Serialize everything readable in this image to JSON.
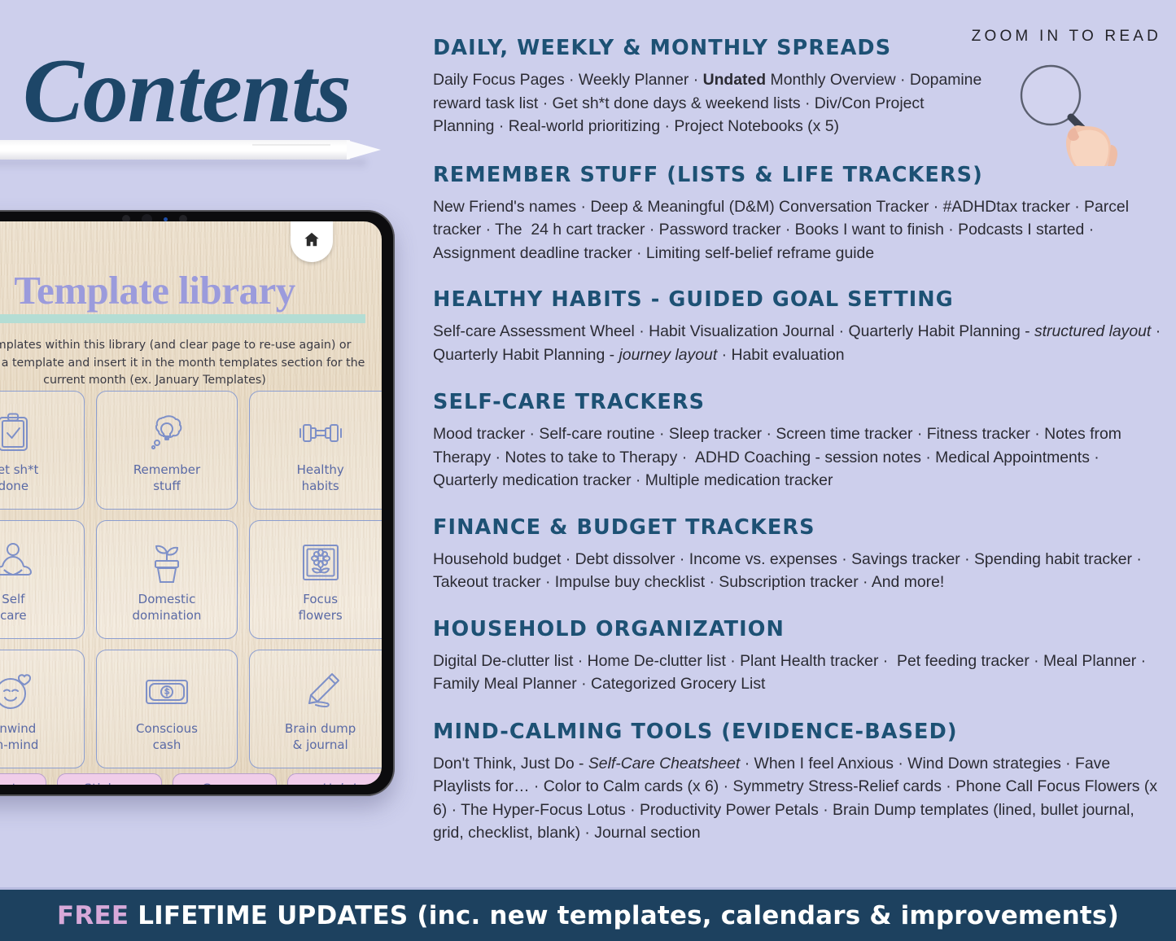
{
  "page": {
    "title": "Contents",
    "background_color": "#cdcfec",
    "heading_color": "#1d5174",
    "body_text_color": "#2b2b33"
  },
  "zoom_hint": {
    "label": "ZOOM IN TO READ",
    "icon": "magnifying-glass-in-hand"
  },
  "tablet": {
    "home_icon": "home-icon",
    "library_title": "Template library",
    "library_description": "Use templates within this library (and clear page to re-use again) or duplicate a template and insert it in the month templates section for the current month (ex. January Templates)",
    "tiles": [
      {
        "caption": "Get sh*t\ndone",
        "icon": "clipboard-check-icon"
      },
      {
        "caption": "Remember\nstuff",
        "icon": "lightbulb-thought-icon"
      },
      {
        "caption": "Healthy\nhabits",
        "icon": "dumbbell-icon"
      },
      {
        "caption": "Self\ncare",
        "icon": "meditation-icon"
      },
      {
        "caption": "Domestic\ndomination",
        "icon": "potted-plant-icon"
      },
      {
        "caption": "Focus\nflowers",
        "icon": "framed-flower-icon"
      },
      {
        "caption": "Unwind\nun-mind",
        "icon": "calm-face-heart-icon"
      },
      {
        "caption": "Conscious\ncash",
        "icon": "banknote-dollar-icon"
      },
      {
        "caption": "Brain dump\n& journal",
        "icon": "pencil-writing-icon"
      }
    ],
    "nav_buttons": [
      {
        "label": "Contents",
        "italic": false
      },
      {
        "label": "Stickers",
        "italic": false
      },
      {
        "label": "Covers",
        "italic": false
      },
      {
        "label": "Help!",
        "italic": true
      }
    ]
  },
  "sections": [
    {
      "heading": "Daily, Weekly & Monthly Spreads",
      "body_html": "Daily Focus Pages &middot; Weekly Planner &middot; <b>Undated</b> Monthly Overview &middot; Dopamine reward task list &middot; Get sh*t done days &amp; weekend lists &middot; Div/Con Project Planning &middot; Real-world prioritizing &middot; Project Notebooks (x 5)"
    },
    {
      "heading": "Remember Stuff (Lists & Life Trackers)",
      "body_html": "New Friend's names &middot; Deep &amp; Meaningful (D&amp;M) Conversation Tracker &middot; #ADHDtax tracker &middot; Parcel tracker &middot; The&nbsp; 24 h cart tracker &middot; Password tracker &middot; Books I want to finish &middot; Podcasts I started &middot; Assignment deadline tracker &middot; Limiting self-belief reframe guide"
    },
    {
      "heading": "Healthy Habits - Guided Goal Setting",
      "body_html": "Self-care Assessment Wheel &middot; Habit Visualization Journal &middot; Quarterly Habit Planning - <i>structured layout</i> &middot; Quarterly Habit Planning - <i>journey layout</i> &middot; Habit evaluation"
    },
    {
      "heading": "Self-Care Trackers",
      "body_html": "Mood tracker &middot; Self-care routine &middot; Sleep tracker &middot; Screen time tracker &middot; Fitness tracker &middot; Notes from Therapy &middot; Notes to take to Therapy &middot;&nbsp; ADHD Coaching - session notes &middot; Medical Appointments &middot; Quarterly medication tracker &middot; Multiple medication tracker"
    },
    {
      "heading": "Finance & Budget Trackers",
      "body_html": "Household budget &middot; Debt dissolver &middot; Income vs. expenses &middot; Savings tracker &middot; Spending habit tracker &middot; Takeout tracker &middot; Impulse buy checklist &middot; Subscription tracker &middot; And more!"
    },
    {
      "heading": "Household Organization",
      "body_html": "Digital De-clutter list &middot; Home De-clutter list &middot; Plant Health tracker &middot;&nbsp; Pet feeding tracker &middot; Meal Planner &middot; Family Meal Planner &middot; Categorized Grocery List"
    },
    {
      "heading": "Mind-Calming Tools (Evidence-Based)",
      "body_html": "Don't Think, Just Do - <i>Self-Care Cheatsheet</i> &middot; When I feel Anxious &middot; Wind Down strategies &middot; Fave Playlists for&hellip; &middot; Color to Calm cards (x 6) &middot; Symmetry Stress-Relief cards &middot; Phone Call Focus Flowers (x 6) &middot; The Hyper-Focus Lotus &middot; Productivity Power Petals &middot; Brain Dump templates (lined, bullet journal, grid, checklist, blank) &middot; Journal section"
    }
  ],
  "banner": {
    "free_word": "FREE",
    "rest": " LIFETIME UPDATES (inc. new templates, calendars & improvements)",
    "background_color": "#1d415f",
    "free_color": "#d7a9d9"
  }
}
